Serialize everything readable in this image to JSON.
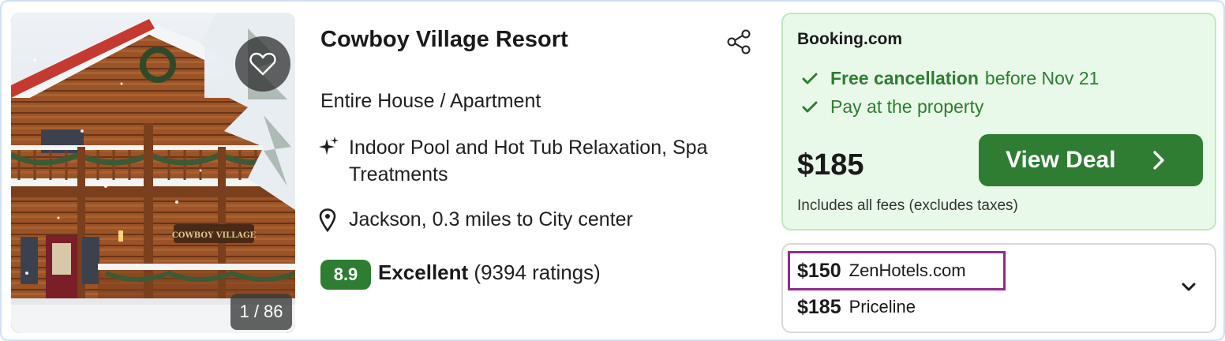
{
  "hotel": {
    "name": "Cowboy Village Resort",
    "type": "Entire House / Apartment",
    "amenity": "Indoor Pool and Hot Tub Relaxation, Spa Treatments",
    "location": "Jackson, 0.3 miles to City center",
    "score": "8.9",
    "rating_word": "Excellent",
    "rating_count": "(9394 ratings)",
    "photo_counter": "1 / 86",
    "sign_text": "COWBOY VILLAGE"
  },
  "deal": {
    "provider": "Booking.com",
    "perks": [
      {
        "bold": "Free cancellation",
        "text": "before Nov 21"
      },
      {
        "bold": "",
        "text": "Pay at the property"
      }
    ],
    "price": "$185",
    "fee_note": "Includes all fees (excludes taxes)",
    "button_label": "View Deal"
  },
  "other_offers": [
    {
      "price": "$150",
      "site": "ZenHotels.com",
      "highlighted": true
    },
    {
      "price": "$185",
      "site": "Priceline",
      "highlighted": false
    }
  ],
  "icons": {
    "favorite": "heart-icon",
    "share": "share-icon",
    "amenity": "sparkle-icon",
    "location": "map-pin-icon",
    "perk": "check-icon",
    "button": "chevron-right-icon",
    "expand": "chevron-down-icon"
  },
  "colors": {
    "accent_green": "#2e7d32",
    "deal_background": "#e9f9e9",
    "deal_border": "#bde8bf",
    "highlight_border": "#8e2c8e"
  }
}
